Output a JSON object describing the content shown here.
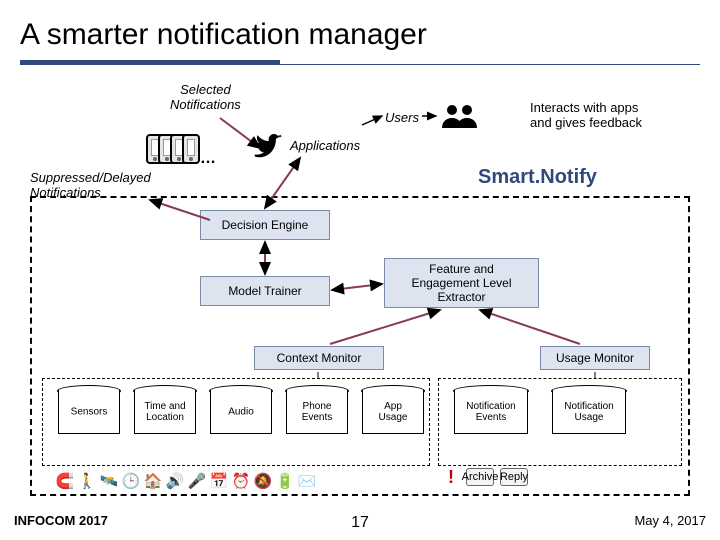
{
  "title": "A smarter notification manager",
  "labels": {
    "selected_notifications": "Selected\nNotifications",
    "users": "Users",
    "interacts": "Interacts with apps\nand gives feedback",
    "applications": "Applications",
    "ellipsis": "…",
    "suppressed": "Suppressed/Delayed\nNotifications",
    "smartnotify": "Smart.Notify",
    "decision_engine": "Decision Engine",
    "model_trainer": "Model Trainer",
    "feature_extractor": "Feature and\nEngagement Level\nExtractor",
    "context_monitor": "Context Monitor",
    "usage_monitor": "Usage Monitor"
  },
  "cylinders": {
    "sensors": "Sensors",
    "time_location": "Time and\nLocation",
    "audio": "Audio",
    "phone_events": "Phone\nEvents",
    "app_usage": "App\nUsage",
    "notif_events": "Notification\nEvents",
    "notif_usage": "Notification\nUsage"
  },
  "footer": {
    "left": "INFOCOM 2017",
    "right": "May 4, 2017",
    "page": "17"
  },
  "buttons": {
    "archive": "Archive",
    "reply": "Reply"
  }
}
